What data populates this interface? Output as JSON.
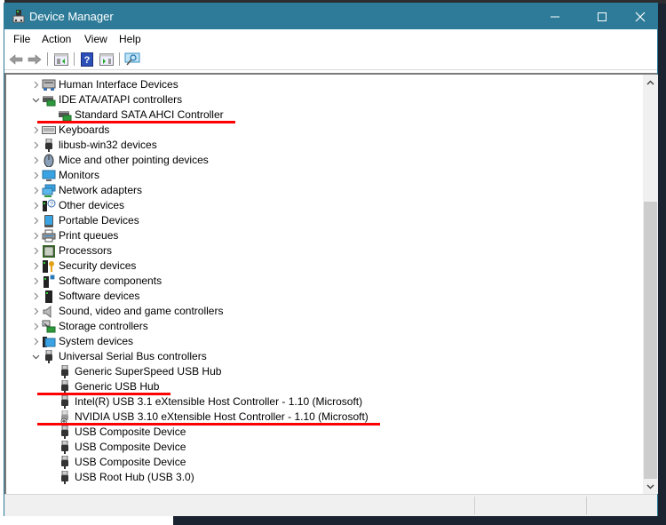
{
  "window": {
    "title": "Device Manager",
    "controls": {
      "minimize": "minimize",
      "maximize": "maximize",
      "close": "close"
    }
  },
  "menu": [
    "File",
    "Action",
    "View",
    "Help"
  ],
  "toolbar": {
    "buttons": [
      "back-icon",
      "forward-icon",
      "show-hide-console-tree-icon",
      "help-icon",
      "properties-icon",
      "scan-hardware-changes-icon"
    ]
  },
  "tree": [
    {
      "label": "Human Interface Devices",
      "level": 0,
      "state": "collapsed",
      "icon": "hid-icon"
    },
    {
      "label": "IDE ATA/ATAPI controllers",
      "level": 0,
      "state": "expanded",
      "icon": "ide-controller-icon"
    },
    {
      "label": "Standard SATA AHCI Controller",
      "level": 1,
      "state": "leaf",
      "icon": "ide-controller-icon",
      "underlined": true
    },
    {
      "label": "Keyboards",
      "level": 0,
      "state": "collapsed",
      "icon": "keyboard-icon"
    },
    {
      "label": "libusb-win32 devices",
      "level": 0,
      "state": "collapsed",
      "icon": "usb-plug-icon"
    },
    {
      "label": "Mice and other pointing devices",
      "level": 0,
      "state": "collapsed",
      "icon": "mouse-icon"
    },
    {
      "label": "Monitors",
      "level": 0,
      "state": "collapsed",
      "icon": "monitor-icon"
    },
    {
      "label": "Network adapters",
      "level": 0,
      "state": "collapsed",
      "icon": "network-adapter-icon"
    },
    {
      "label": "Other devices",
      "level": 0,
      "state": "collapsed",
      "icon": "other-devices-icon"
    },
    {
      "label": "Portable Devices",
      "level": 0,
      "state": "collapsed",
      "icon": "portable-device-icon"
    },
    {
      "label": "Print queues",
      "level": 0,
      "state": "collapsed",
      "icon": "printer-icon"
    },
    {
      "label": "Processors",
      "level": 0,
      "state": "collapsed",
      "icon": "processor-icon"
    },
    {
      "label": "Security devices",
      "level": 0,
      "state": "collapsed",
      "icon": "security-device-icon"
    },
    {
      "label": "Software components",
      "level": 0,
      "state": "collapsed",
      "icon": "software-component-icon"
    },
    {
      "label": "Software devices",
      "level": 0,
      "state": "collapsed",
      "icon": "software-device-icon"
    },
    {
      "label": "Sound, video and game controllers",
      "level": 0,
      "state": "collapsed",
      "icon": "speaker-icon"
    },
    {
      "label": "Storage controllers",
      "level": 0,
      "state": "collapsed",
      "icon": "storage-controller-icon"
    },
    {
      "label": "System devices",
      "level": 0,
      "state": "collapsed",
      "icon": "system-device-icon"
    },
    {
      "label": "Universal Serial Bus controllers",
      "level": 0,
      "state": "expanded",
      "icon": "usb-plug-icon"
    },
    {
      "label": "Generic SuperSpeed USB Hub",
      "level": 1,
      "state": "leaf",
      "icon": "usb-plug-icon"
    },
    {
      "label": "Generic USB Hub",
      "level": 1,
      "state": "leaf",
      "icon": "usb-plug-icon",
      "underlined": true
    },
    {
      "label": "Intel(R) USB 3.1 eXtensible Host Controller - 1.10 (Microsoft)",
      "level": 1,
      "state": "leaf",
      "icon": "usb-plug-icon"
    },
    {
      "label": "NVIDIA USB 3.10 eXtensible Host Controller - 1.10 (Microsoft)",
      "level": 1,
      "state": "leaf",
      "icon": "usb-plug-downloading-icon",
      "underlined": true
    },
    {
      "label": "USB Composite Device",
      "level": 1,
      "state": "leaf",
      "icon": "usb-plug-icon"
    },
    {
      "label": "USB Composite Device",
      "level": 1,
      "state": "leaf",
      "icon": "usb-plug-icon"
    },
    {
      "label": "USB Composite Device",
      "level": 1,
      "state": "leaf",
      "icon": "usb-plug-icon"
    },
    {
      "label": "USB Root Hub (USB 3.0)",
      "level": 1,
      "state": "leaf",
      "icon": "usb-plug-icon"
    }
  ],
  "annotation_color": "#ff0000",
  "scrollbar": {
    "position_fraction": 0.3,
    "visible_fraction": 0.68
  },
  "colors": {
    "titlebar": "#2d7b98"
  }
}
